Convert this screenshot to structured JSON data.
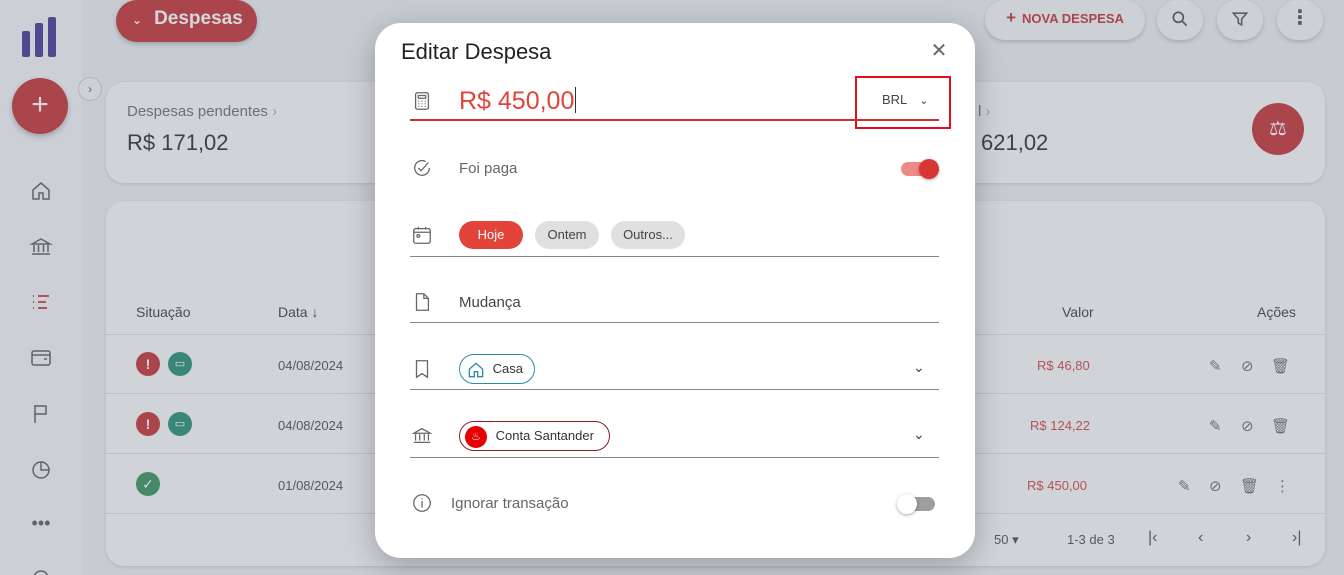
{
  "app": {
    "section_title": "Despesas",
    "new_button": "NOVA DESPESA",
    "nav": [
      "home-icon",
      "bank-icon",
      "list-icon",
      "wallet-icon",
      "flag-icon",
      "pie-chart-icon",
      "more-icon",
      "gear-icon"
    ]
  },
  "summary": {
    "pending_label": "Despesas pendentes",
    "pending_value": "R$ 171,02",
    "total_label": "l",
    "total_value": "621,02"
  },
  "table": {
    "headers": {
      "status": "Situação",
      "date": "Data",
      "value": "Valor",
      "actions": "Ações"
    },
    "rows": [
      {
        "status": "pending",
        "date": "04/08/2024",
        "value": "R$ 46,80"
      },
      {
        "status": "pending",
        "date": "04/08/2024",
        "value": "R$ 124,22"
      },
      {
        "status": "paid",
        "date": "01/08/2024",
        "value": "R$ 450,00"
      }
    ],
    "pagination": {
      "per_page": "50",
      "range": "1-3 de 3"
    }
  },
  "modal": {
    "title": "Editar Despesa",
    "amount": "R$ 450,00",
    "currency": "BRL",
    "paid_label": "Foi paga",
    "paid": true,
    "date_chips": [
      "Hoje",
      "Ontem",
      "Outros..."
    ],
    "selected_date_chip": "Hoje",
    "description": "Mudança",
    "category": "Casa",
    "account": "Conta Santander",
    "ignore_label": "Ignorar transação",
    "ignore": false
  }
}
